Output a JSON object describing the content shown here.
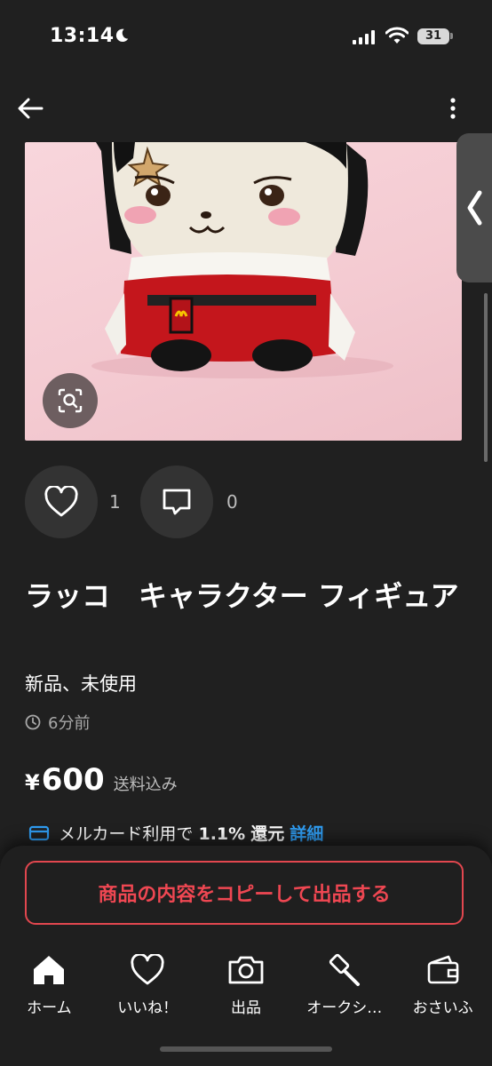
{
  "status_bar": {
    "time": "13:14",
    "battery": "31"
  },
  "product": {
    "likes": "1",
    "comments": "0",
    "title": "ラッコ　キャラクター フィギュア",
    "condition": "新品、未使用",
    "posted": "6分前",
    "currency": "¥",
    "price": "600",
    "shipping": "送料込み"
  },
  "card_promo": {
    "prefix": "メルカード利用で",
    "rate": "1.1%",
    "suffix": "還元",
    "link": "詳細"
  },
  "cta": {
    "copy_label": "商品の内容をコピーして出品する"
  },
  "tabbar": [
    {
      "label": "ホーム",
      "icon": "home-icon"
    },
    {
      "label": "いいね！",
      "icon": "heart-icon"
    },
    {
      "label": "出品",
      "icon": "camera-icon"
    },
    {
      "label": "オークシ…",
      "icon": "gavel-icon"
    },
    {
      "label": "おさいふ",
      "icon": "wallet-icon"
    }
  ],
  "colors": {
    "background": "#202020",
    "accent": "#ef4752",
    "link": "#2f9cf1"
  }
}
